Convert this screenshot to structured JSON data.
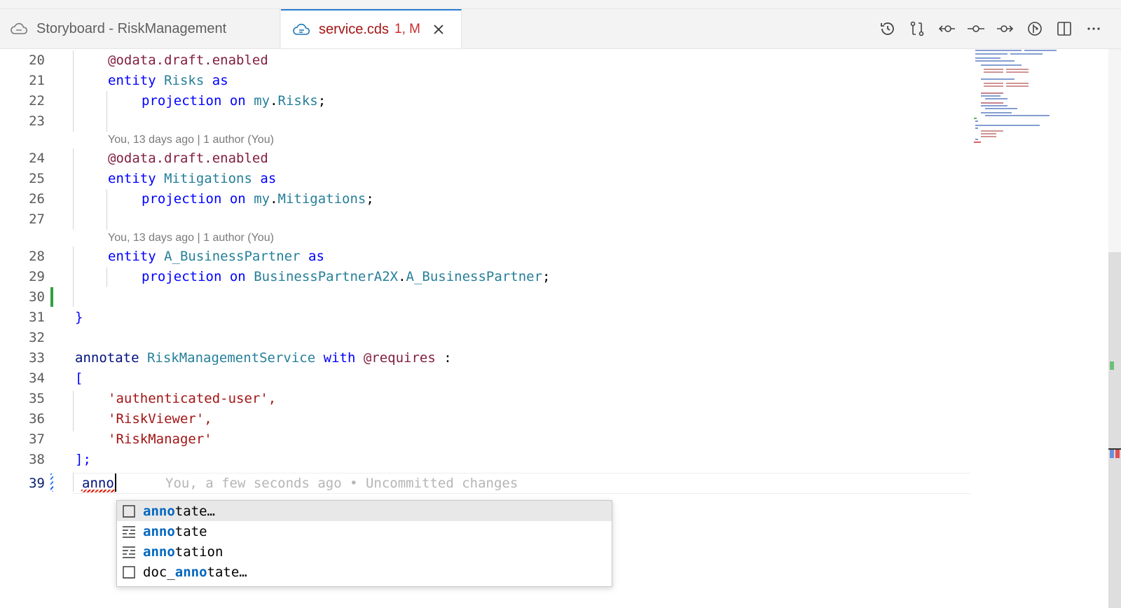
{
  "tabs": [
    {
      "label": "Storyboard - RiskManagement",
      "icon": "cloud-icon",
      "active": false
    },
    {
      "label": "service.cds",
      "badge": "1, M",
      "icon": "cloud-file-icon",
      "active": true
    }
  ],
  "toolbar": [
    "history-icon",
    "compare-changes-icon",
    "previous-change-icon",
    "commit-icon",
    "next-change-icon",
    "git-lens-icon",
    "split-editor-icon",
    "more-actions-icon"
  ],
  "lines": [
    {
      "n": "20",
      "code": "@odata.draft.enabled"
    },
    {
      "n": "21",
      "code": "entity Risks as"
    },
    {
      "n": "22",
      "code": "projection on my.Risks;"
    },
    {
      "n": "23",
      "code": ""
    },
    {
      "n": "24",
      "code": "@odata.draft.enabled"
    },
    {
      "n": "25",
      "code": "entity Mitigations as"
    },
    {
      "n": "26",
      "code": "projection on my.Mitigations;"
    },
    {
      "n": "27",
      "code": ""
    },
    {
      "n": "28",
      "code": "entity A_BusinessPartner as"
    },
    {
      "n": "29",
      "code": "projection on BusinessPartnerA2X.A_BusinessPartner;"
    },
    {
      "n": "30",
      "code": ""
    },
    {
      "n": "31",
      "code": "}"
    },
    {
      "n": "32",
      "code": ""
    },
    {
      "n": "33",
      "code": "annotate RiskManagementService with @requires :"
    },
    {
      "n": "34",
      "code": "["
    },
    {
      "n": "35",
      "code": "'authenticated-user',"
    },
    {
      "n": "36",
      "code": "'RiskViewer',"
    },
    {
      "n": "37",
      "code": "'RiskManager'"
    },
    {
      "n": "38",
      "code": "];"
    },
    {
      "n": "39",
      "code": "anno"
    }
  ],
  "blame": [
    "You, 13 days ago | 1 author (You)",
    "You, 13 days ago | 1 author (You)"
  ],
  "inline_blame": "You, a few seconds ago • Uncommitted changes",
  "suggestions": [
    {
      "match": "anno",
      "rest": "tate…",
      "prefix": "",
      "icon": "snippet-icon",
      "selected": true
    },
    {
      "match": "anno",
      "rest": "tate",
      "prefix": "",
      "icon": "keyword-icon",
      "selected": false
    },
    {
      "match": "anno",
      "rest": "tation",
      "prefix": "",
      "icon": "keyword-icon",
      "selected": false
    },
    {
      "match": "anno",
      "rest": "tate…",
      "prefix": "doc_",
      "icon": "snippet-icon",
      "selected": false
    }
  ],
  "colors": {
    "accent": "#2b7bd4",
    "tab_active_text": "#a31515",
    "git_added": "#2ea043"
  }
}
